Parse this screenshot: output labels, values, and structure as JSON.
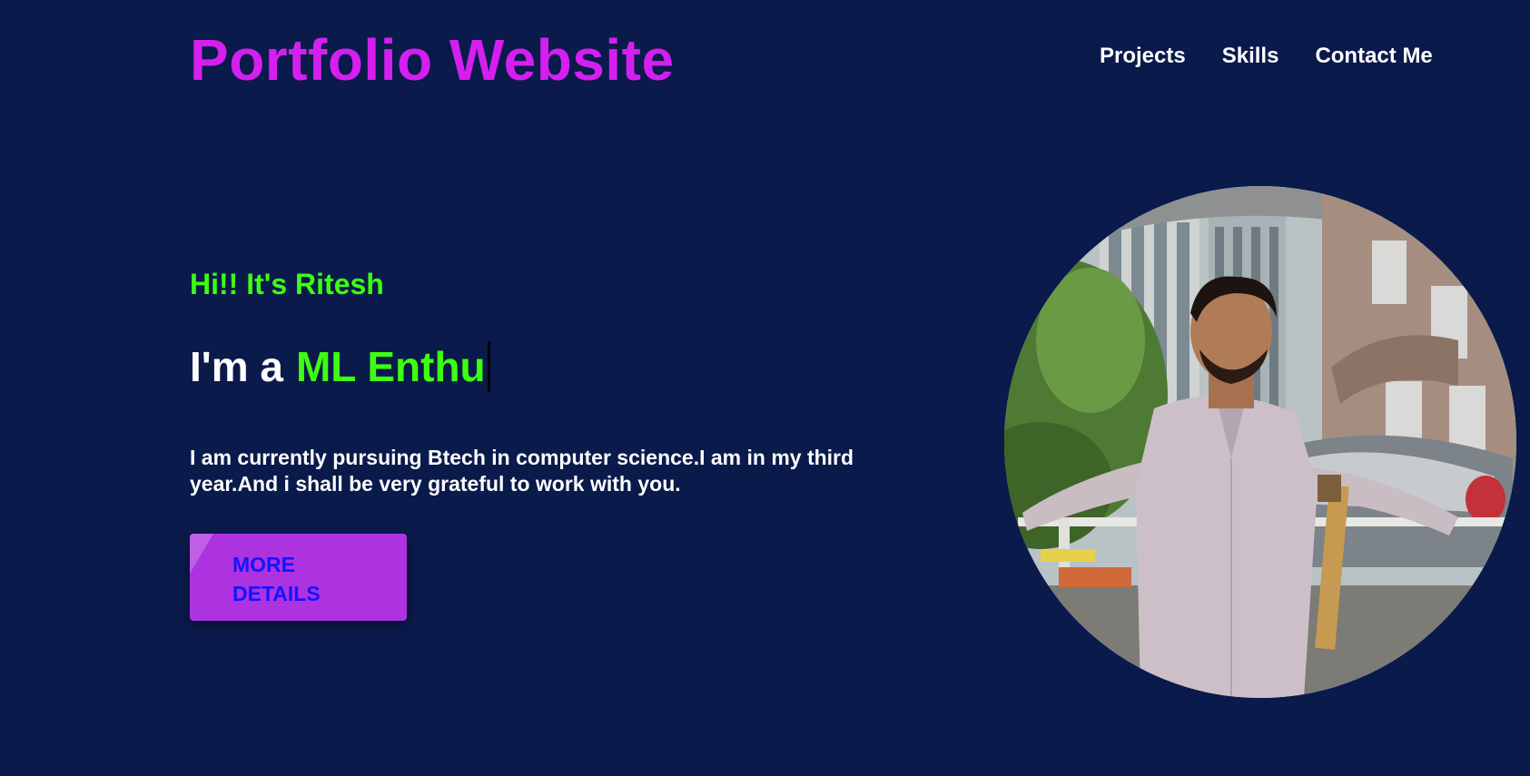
{
  "header": {
    "title": "Portfolio Website",
    "nav": [
      {
        "label": "Projects"
      },
      {
        "label": "Skills"
      },
      {
        "label": "Contact Me"
      }
    ]
  },
  "hero": {
    "greeting": "Hi!! It's Ritesh",
    "role_prefix": "I'm a",
    "role_typed": "ML Enthu",
    "bio": "I am currently pursuing Btech in computer science.I am in my third year.And i shall be very grateful to work with you.",
    "button_label": "MORE DETAILS"
  },
  "colors": {
    "background": "#0a1a4b",
    "title": "#d51ff0",
    "accent_green": "#3dff12",
    "button_bg": "#ad33e0",
    "button_text": "#1414ff",
    "text": "#ffffff"
  }
}
